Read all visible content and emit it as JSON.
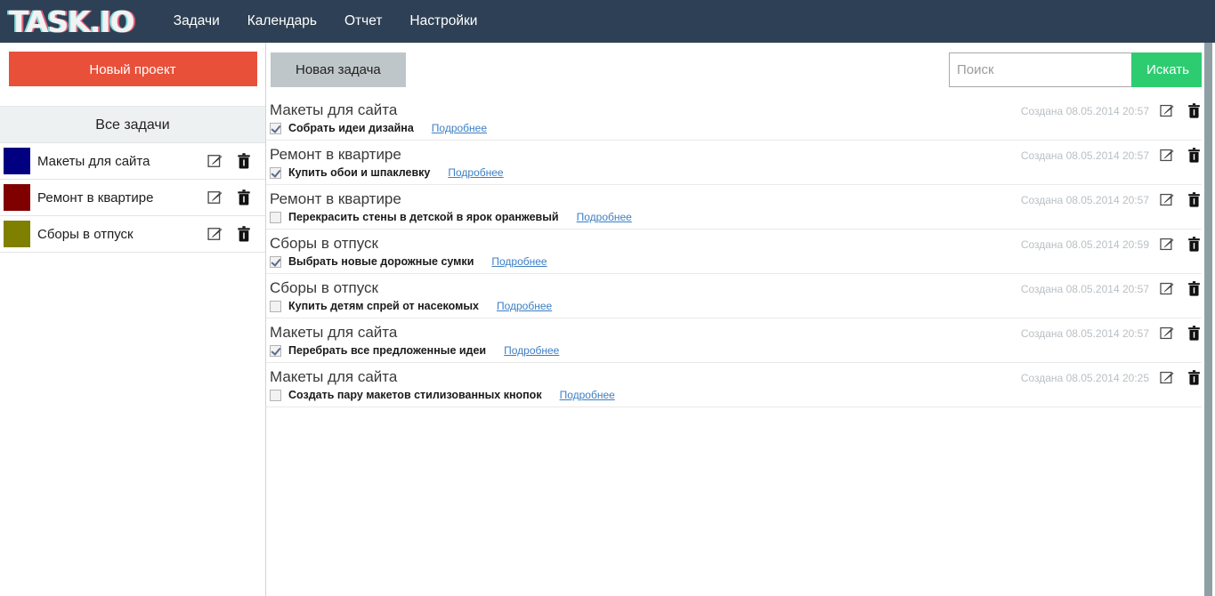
{
  "navbar": {
    "logo": "TASK.IO",
    "links": [
      {
        "label": "Задачи"
      },
      {
        "label": "Календарь"
      },
      {
        "label": "Отчет"
      },
      {
        "label": "Настройки"
      }
    ]
  },
  "sidebar": {
    "new_project_label": "Новый проект",
    "all_tasks_label": "Все задачи",
    "projects": [
      {
        "name": "Макеты для сайта",
        "color": "#000080"
      },
      {
        "name": "Ремонт в квартире",
        "color": "#800000"
      },
      {
        "name": "Сборы в отпуск",
        "color": "#808000"
      }
    ]
  },
  "toolbar": {
    "new_task_label": "Новая задача",
    "search_placeholder": "Поиск",
    "search_value": "",
    "search_button_label": "Искать"
  },
  "tasks": {
    "details_label": "Подробнее",
    "items": [
      {
        "project": "Макеты для сайта",
        "text": "Собрать идеи дизайна",
        "done": true,
        "created": "Создана 08.05.2014 20:57"
      },
      {
        "project": "Ремонт в квартире",
        "text": "Купить обои и шпаклевку",
        "done": true,
        "created": "Создана 08.05.2014 20:57"
      },
      {
        "project": "Ремонт в квартире",
        "text": "Перекрасить стены в детской в ярок оранжевый",
        "done": false,
        "created": "Создана 08.05.2014 20:57"
      },
      {
        "project": "Сборы в отпуск",
        "text": "Выбрать новые дорожные сумки",
        "done": true,
        "created": "Создана 08.05.2014 20:59"
      },
      {
        "project": "Сборы в отпуск",
        "text": "Купить детям спрей от насекомых",
        "done": false,
        "created": "Создана 08.05.2014 20:57"
      },
      {
        "project": "Макеты для сайта",
        "text": "Перебрать все предложенные идеи",
        "done": true,
        "created": "Создана 08.05.2014 20:57"
      },
      {
        "project": "Макеты для сайта",
        "text": "Создать пару макетов стилизованных кнопок",
        "done": false,
        "created": "Создана 08.05.2014 20:25"
      }
    ]
  },
  "colors": {
    "navbar_bg": "#2e4055",
    "new_project_bg": "#e8503a",
    "search_button_bg": "#2ecc71",
    "link_blue": "#3c7fc4"
  }
}
